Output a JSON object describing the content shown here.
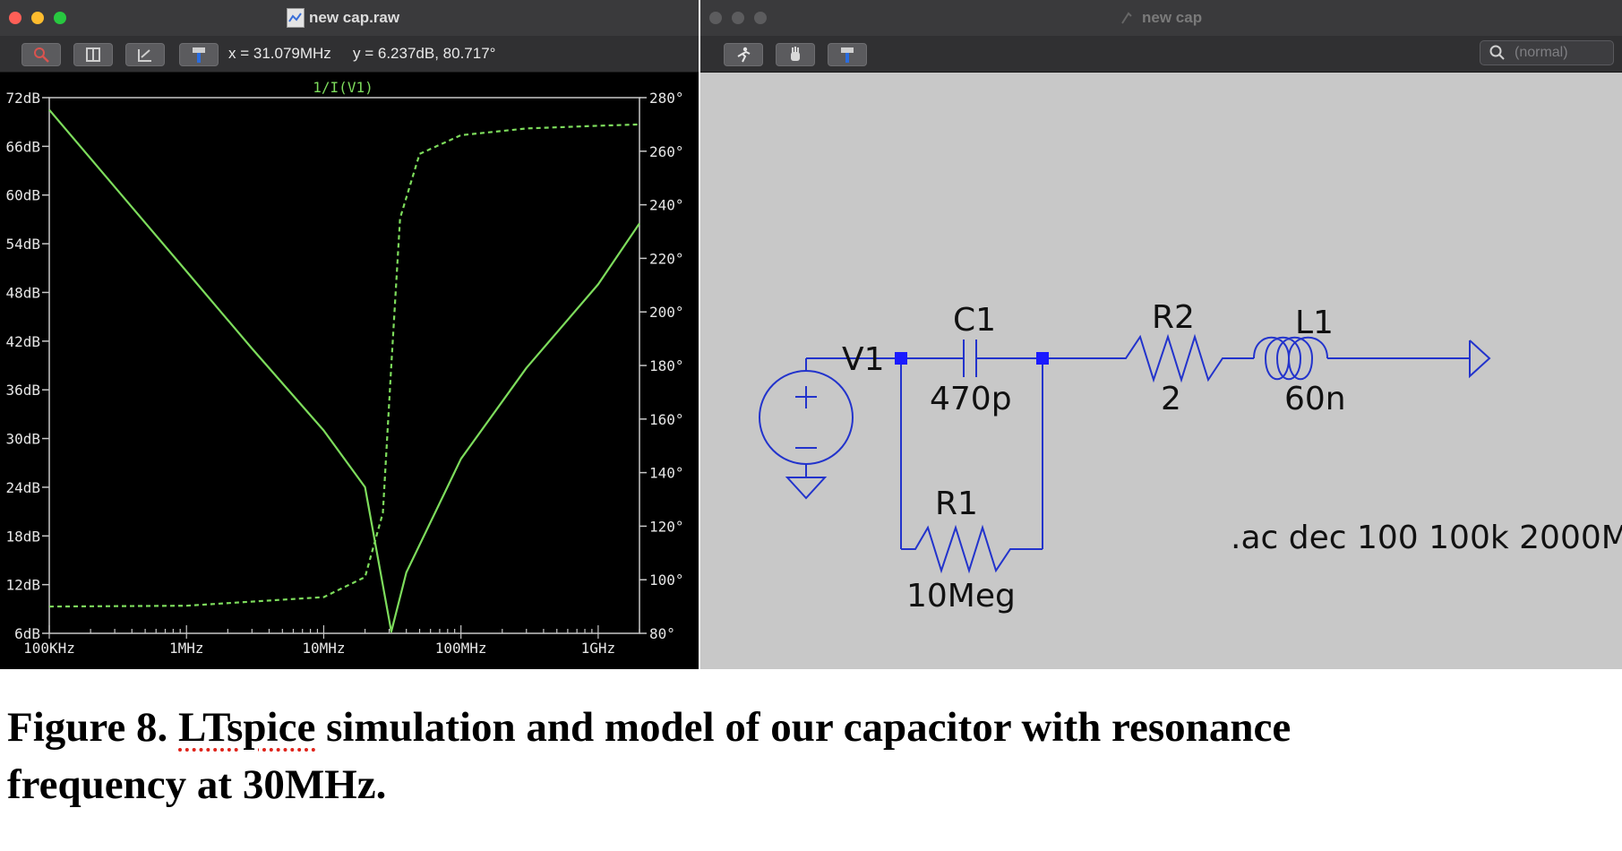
{
  "left_window": {
    "title": "new cap.raw",
    "cursor_x": "x = 31.079MHz",
    "cursor_y": "y = 6.237dB, 80.717°",
    "trace_label": "1/I(V1)"
  },
  "right_window": {
    "title": "new cap",
    "search_placeholder": "(normal)"
  },
  "chart_data": {
    "type": "line",
    "title": "1/I(V1)",
    "x_scale": "log",
    "xlim_hz": [
      100000,
      2000000000
    ],
    "x_ticks": [
      "100KHz",
      "1MHz",
      "10MHz",
      "100MHz",
      "1GHz"
    ],
    "y_left_ticks": [
      "72dB",
      "66dB",
      "60dB",
      "54dB",
      "48dB",
      "42dB",
      "36dB",
      "30dB",
      "24dB",
      "18dB",
      "12dB",
      "6dB"
    ],
    "y_right_ticks": [
      "280°",
      "260°",
      "240°",
      "220°",
      "200°",
      "180°",
      "160°",
      "140°",
      "120°",
      "100°",
      "80°"
    ],
    "ylim_db": [
      6,
      72
    ],
    "ylim_deg": [
      80,
      280
    ],
    "grid": false,
    "colors": {
      "trace": "#7ddc5c",
      "background": "#000000",
      "axes": "#c8c8c8"
    },
    "series": [
      {
        "kind": "magnitude",
        "style": "solid",
        "x": [
          100000,
          300000,
          1000000,
          3000000,
          10000000,
          20000000,
          31079000,
          40000000,
          100000000,
          300000000,
          1000000000,
          2000000000
        ],
        "y": [
          70.5,
          61.0,
          50.6,
          41.1,
          31.0,
          24.0,
          6.2,
          13.5,
          27.5,
          38.7,
          49.0,
          56.5
        ]
      },
      {
        "kind": "phase",
        "style": "dashed",
        "x": [
          100000,
          1000000,
          10000000,
          20000000,
          27000000,
          31079000,
          36000000,
          50000000,
          100000000,
          300000000,
          1000000000,
          2000000000
        ],
        "y": [
          90,
          90.3,
          93.5,
          101,
          125,
          180,
          235,
          259,
          266,
          268.5,
          269.5,
          270
        ]
      }
    ]
  },
  "schematic": {
    "source": "V1",
    "c1": {
      "name": "C1",
      "value": "470p"
    },
    "r1": {
      "name": "R1",
      "value": "10Meg"
    },
    "r2": {
      "name": "R2",
      "value": "2"
    },
    "l1": {
      "name": "L1",
      "value": "60n"
    },
    "directive": ".ac dec 100 100k 2000M",
    "wire_color": "#2233cc",
    "node_color": "#1a1aff"
  },
  "caption": {
    "prefix": "Figure 8. ",
    "flagged_word": "LTspice",
    "rest_line1": " simulation and model of our capacitor with resonance",
    "line2": "frequency at 30MHz."
  }
}
